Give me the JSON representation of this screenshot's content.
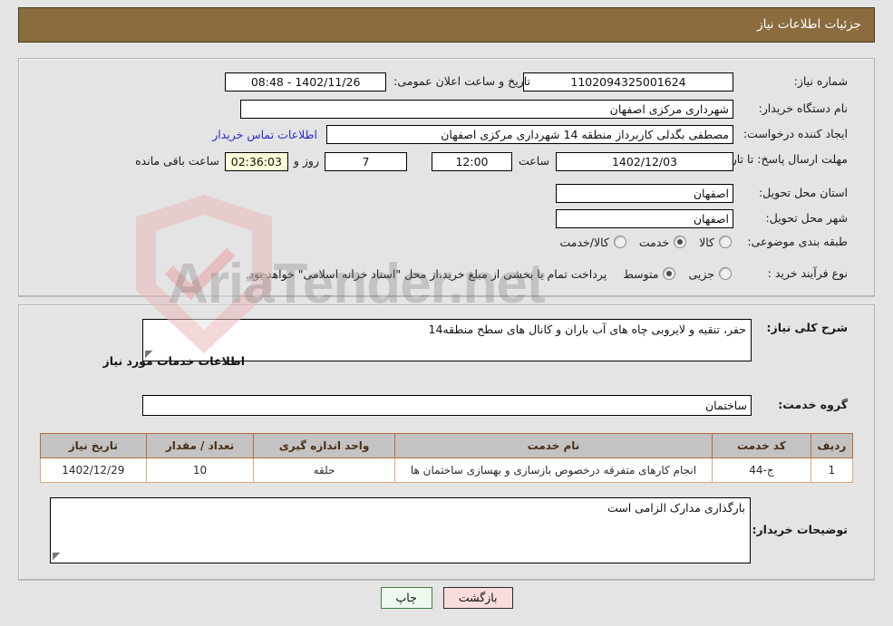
{
  "header": {
    "title": "جزئیات اطلاعات نیاز"
  },
  "top_form": {
    "need_number": {
      "label": "شماره نیاز:",
      "value": "1102094325001624"
    },
    "announce": {
      "label": "تاریخ و ساعت اعلان عمومی:",
      "value": "1402/11/26 - 08:48"
    },
    "buyer_org": {
      "label": "نام دستگاه خریدار:",
      "value": "شهرداری مرکزی اصفهان"
    },
    "creator": {
      "label": "ایجاد کننده درخواست:",
      "value": "مصطفی بگدلی کاربرداز منطقه 14 شهرداری مرکزی اصفهان",
      "contact_link": "اطلاعات تماس خریدار"
    },
    "deadline": {
      "label": "مهلت ارسال پاسخ: تا تاریخ:",
      "date": "1402/12/03",
      "hour_label": "ساعت",
      "hour": "12:00",
      "days": "7",
      "days_sep": "روز و",
      "countdown": "02:36:03",
      "remaining_label": "ساعت باقی مانده"
    },
    "province": {
      "label": "استان محل تحویل:",
      "value": "اصفهان"
    },
    "city": {
      "label": "شهر محل تحویل:",
      "value": "اصفهان"
    },
    "category": {
      "label": "طبقه بندی موضوعی:",
      "options": [
        {
          "text": "کالا",
          "selected": false
        },
        {
          "text": "خدمت",
          "selected": true
        },
        {
          "text": "کالا/خدمت",
          "selected": false
        }
      ]
    },
    "process_type": {
      "label": "نوع فرآیند خرید :",
      "options": [
        {
          "text": "جزیی",
          "selected": false
        },
        {
          "text": "متوسط",
          "selected": true
        }
      ],
      "note": "پرداخت تمام یا بخشی از مبلغ خرید،از محل \"اسناد خزانه اسلامی\" خواهد بود."
    }
  },
  "bottom_form": {
    "general_desc": {
      "label": "شرح کلی نیاز:",
      "value": "حفر، تنقیه و لایروبی چاه های آب باران و کانال های سطح منطقه14"
    },
    "services_section_title": "اطلاعات خدمات مورد نیاز",
    "service_group": {
      "label": "گروه خدمت:",
      "value": "ساختمان"
    },
    "table": {
      "columns": [
        "ردیف",
        "کد خدمت",
        "نام خدمت",
        "واحد اندازه گیری",
        "تعداد / مقدار",
        "تاریخ نیاز"
      ],
      "rows": [
        {
          "radif": "1",
          "code": "ج-44",
          "name": "انجام کارهای متفرقه درخصوص بازسازی و بهسازی ساختمان ها",
          "unit": "حلقه",
          "qty": "10",
          "date": "1402/12/29"
        }
      ]
    },
    "buyer_notes": {
      "label": "توضیحات خریدار:",
      "value": "بارگذاری مدارک الزامی است"
    }
  },
  "footer": {
    "back_button": "بازگشت",
    "print_button": "چاپ"
  },
  "watermark": {
    "text": "AriaTender.net"
  }
}
